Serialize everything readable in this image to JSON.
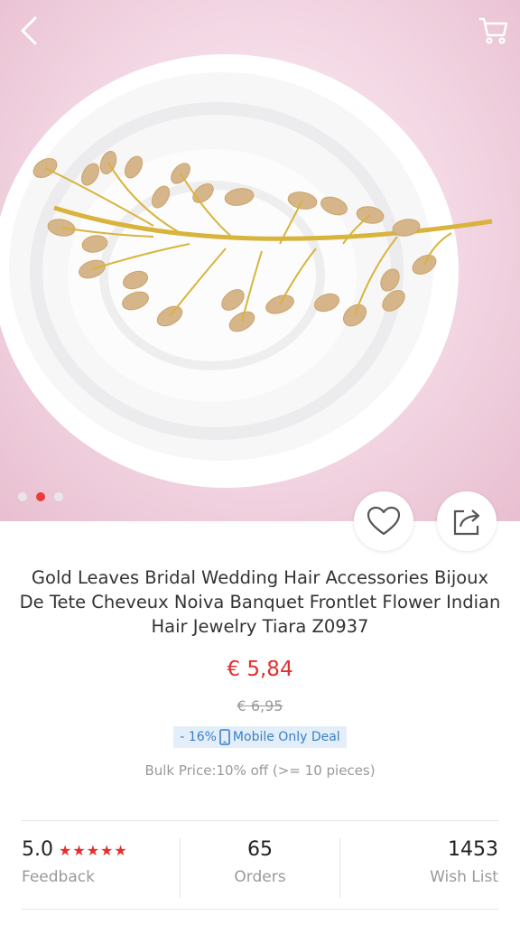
{
  "nav": {
    "back_icon": "chevron-left-icon",
    "cart_icon": "cart-icon"
  },
  "gallery": {
    "pages": 3,
    "active_page": 2
  },
  "actions": {
    "wishlist_icon": "heart-icon",
    "share_icon": "share-icon"
  },
  "product": {
    "title": "Gold Leaves Bridal Wedding Hair Accessories Bijoux De Tete Cheveux Noiva Banquet Frontlet Flower Indian Hair Jewelry Tiara Z0937",
    "price": "€ 5,84",
    "original_price": "€ 6,95",
    "deal": {
      "discount": "- 16%",
      "label": "Mobile Only Deal",
      "icon": "phone-icon"
    },
    "bulk_price": "Bulk Price:10% off (>= 10 pieces)"
  },
  "stats": {
    "rating": "5.0",
    "stars": "★★★★★",
    "rating_label": "Feedback",
    "orders": "65",
    "orders_label": "Orders",
    "wishlist": "1453",
    "wishlist_label": "Wish List"
  },
  "colors": {
    "accent": "#e62e2e",
    "deal_bg": "#e3eef8",
    "deal_text": "#3a7fc8"
  }
}
